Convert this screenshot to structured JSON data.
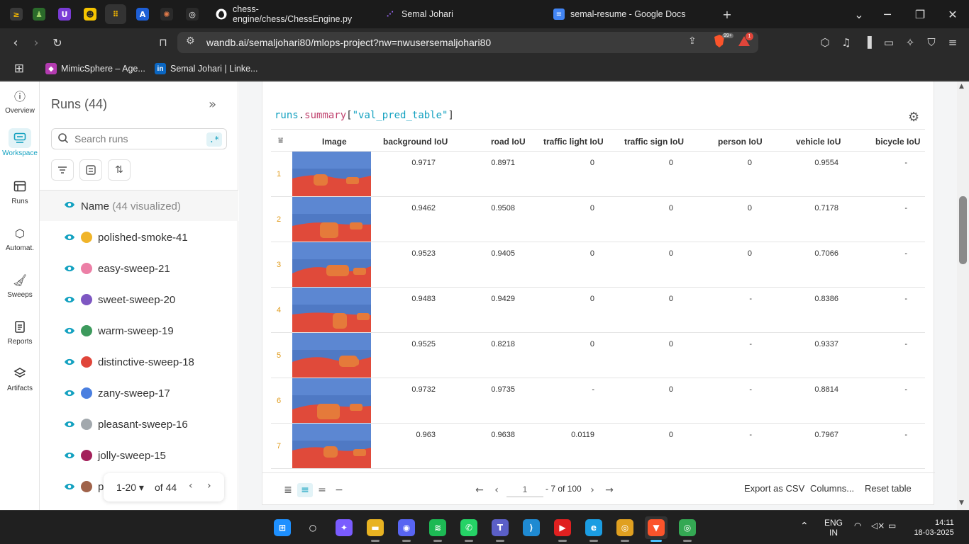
{
  "browser": {
    "pinned_tabs": [
      {
        "name": "pinned-tab-1",
        "glyph": "≥",
        "color": "#3a3a3a",
        "fg": "#f5b800"
      },
      {
        "name": "pinned-tab-2",
        "glyph": "♟",
        "color": "#2b6b2b",
        "fg": "#9fd36b"
      },
      {
        "name": "pinned-tab-3",
        "glyph": "U",
        "color": "#7a3cd6",
        "fg": "#ffffff"
      },
      {
        "name": "pinned-tab-4",
        "glyph": "☻",
        "color": "#f5c400",
        "fg": "#222222"
      },
      {
        "name": "pinned-tab-5",
        "glyph": "⠿",
        "color": "#333333",
        "fg": "#f5b800"
      },
      {
        "name": "pinned-tab-6",
        "glyph": "A",
        "color": "#1e5fd6",
        "fg": "#ffffff"
      },
      {
        "name": "pinned-tab-7",
        "glyph": "✺",
        "color": "#2a2a2a",
        "fg": "#e07a4a"
      },
      {
        "name": "pinned-tab-8",
        "glyph": "◎",
        "color": "#2a2a2a",
        "fg": "#ffffff"
      }
    ],
    "tabs": [
      {
        "title": "chess-engine/chess/ChessEngine.py",
        "icon": "github-icon"
      },
      {
        "title": "Semal Johari",
        "icon": "wandb-icon"
      },
      {
        "title": "semal-resume - Google Docs",
        "icon": "docs-icon"
      }
    ],
    "new_tab": "+",
    "url": "wandb.ai/semaljohari80/mlops-project?nw=nwusersemaljohari80",
    "brave_badge": "99+",
    "alert_badge": "1",
    "bookmarks": [
      {
        "label": "MimicSphere – Age...",
        "icon": "mimicsphere-icon"
      },
      {
        "label": "Semal Johari | Linke...",
        "icon": "linkedin-icon"
      }
    ]
  },
  "leftnav": [
    {
      "label": "Overview",
      "icon": "info-icon"
    },
    {
      "label": "Workspace",
      "icon": "workspace-icon"
    },
    {
      "label": "Runs",
      "icon": "table-icon"
    },
    {
      "label": "Automat.",
      "icon": "automation-icon"
    },
    {
      "label": "Sweeps",
      "icon": "broom-icon"
    },
    {
      "label": "Reports",
      "icon": "report-icon"
    },
    {
      "label": "Artifacts",
      "icon": "layers-icon"
    }
  ],
  "runs": {
    "title": "Runs (44)",
    "search_placeholder": "Search runs",
    "regex": ".*",
    "header_name": "Name",
    "header_count": "(44 visualized)",
    "items": [
      {
        "name": "polished-smoke-41",
        "color": "#f0b429"
      },
      {
        "name": "easy-sweep-21",
        "color": "#ec7fa6"
      },
      {
        "name": "sweet-sweep-20",
        "color": "#7e57c2"
      },
      {
        "name": "warm-sweep-19",
        "color": "#3d9a5d"
      },
      {
        "name": "distinctive-sweep-18",
        "color": "#e0453a"
      },
      {
        "name": "zany-sweep-17",
        "color": "#4a7fe0"
      },
      {
        "name": "pleasant-sweep-16",
        "color": "#a2a8ad"
      },
      {
        "name": "jolly-sweep-15",
        "color": "#a3205a"
      },
      {
        "name": "p",
        "color": "#a0634a"
      }
    ],
    "pager": {
      "range": "1-20",
      "of": "of 44"
    }
  },
  "table": {
    "expr": {
      "a": "runs",
      "b": ".",
      "c": "summary",
      "d": "[",
      "e": "\"val_pred_table\"",
      "f": "]"
    },
    "columns": [
      "Image",
      "background IoU",
      "road IoU",
      "traffic light IoU",
      "traffic sign IoU",
      "person IoU",
      "vehicle IoU",
      "bicycle IoU"
    ],
    "rows": [
      {
        "idx": "1",
        "vals": [
          "0.9717",
          "0.8971",
          "0",
          "0",
          "0",
          "0.9554",
          "-"
        ]
      },
      {
        "idx": "2",
        "vals": [
          "0.9462",
          "0.9508",
          "0",
          "0",
          "0",
          "0.7178",
          "-"
        ]
      },
      {
        "idx": "3",
        "vals": [
          "0.9523",
          "0.9405",
          "0",
          "0",
          "0",
          "0.7066",
          "-"
        ]
      },
      {
        "idx": "4",
        "vals": [
          "0.9483",
          "0.9429",
          "0",
          "0",
          "-",
          "0.8386",
          "-"
        ]
      },
      {
        "idx": "5",
        "vals": [
          "0.9525",
          "0.8218",
          "0",
          "0",
          "-",
          "0.9337",
          "-"
        ]
      },
      {
        "idx": "6",
        "vals": [
          "0.9732",
          "0.9735",
          "-",
          "0",
          "-",
          "0.8814",
          "-"
        ]
      },
      {
        "idx": "7",
        "vals": [
          "0.963",
          "0.9638",
          "0.0119",
          "0",
          "-",
          "0.7967",
          "-"
        ]
      }
    ],
    "footer": {
      "page": "1",
      "page_of": "- 7 of 100",
      "export": "Export as CSV",
      "columns": "Columns...",
      "reset": "Reset table"
    }
  },
  "taskbar": {
    "apps": [
      {
        "name": "start-icon",
        "glyph": "⊞",
        "color": "#1e90ff"
      },
      {
        "name": "search-icon",
        "glyph": "○",
        "color": "#202020"
      },
      {
        "name": "copilot-icon",
        "glyph": "✦",
        "color": "#7a5cff"
      },
      {
        "name": "file-explorer-icon",
        "glyph": "▬",
        "color": "#e8b322"
      },
      {
        "name": "discord-icon",
        "glyph": "◉",
        "color": "#5865f2"
      },
      {
        "name": "spotify-icon",
        "glyph": "≋",
        "color": "#1db954"
      },
      {
        "name": "whatsapp-icon",
        "glyph": "✆",
        "color": "#25d366"
      },
      {
        "name": "teams-icon",
        "glyph": "T",
        "color": "#5b5fc7"
      },
      {
        "name": "vscode-icon",
        "glyph": "⟩",
        "color": "#1f8ad2"
      },
      {
        "name": "youtube-icon",
        "glyph": "▶",
        "color": "#e02020"
      },
      {
        "name": "edge-icon",
        "glyph": "e",
        "color": "#1b9de2"
      },
      {
        "name": "chrome-icon",
        "glyph": "◎",
        "color": "#e0a020"
      },
      {
        "name": "brave-icon",
        "glyph": "▼",
        "color": "#fb542b"
      },
      {
        "name": "chrome-profile-icon",
        "glyph": "◎",
        "color": "#34a853"
      }
    ],
    "lang": "ENG",
    "region": "IN",
    "time": "14:11",
    "date": "18-03-2025"
  }
}
